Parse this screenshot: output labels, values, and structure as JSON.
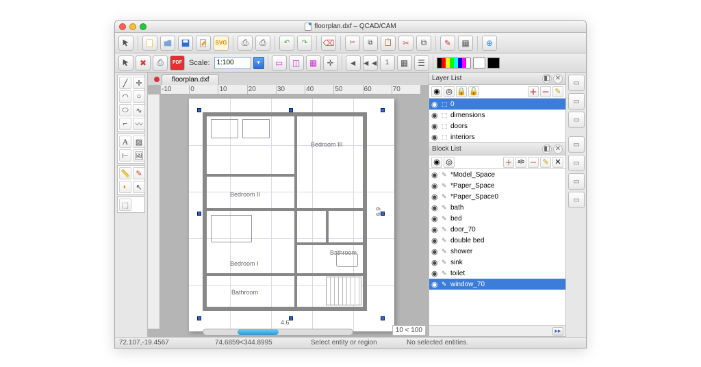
{
  "window": {
    "title": "floorplan.dxf – QCAD/CAM"
  },
  "tab": {
    "label": "floorplan.dxf"
  },
  "toolbar2": {
    "scale_label": "Scale:",
    "scale_value": "1:100",
    "page_num": "1"
  },
  "ruler_h": [
    "-10",
    "0",
    "10",
    "20",
    "30",
    "40",
    "50",
    "60",
    "70"
  ],
  "rooms": {
    "br3": "Bedroom III",
    "br2": "Bedroom II",
    "br1": "Bedroom I",
    "bath1": "Bathroom",
    "bath2": "Bathroom"
  },
  "dims": {
    "width": "4.6",
    "height": "6.9"
  },
  "zoom": "10 < 100",
  "layer_panel": {
    "title": "Layer List",
    "items": [
      {
        "name": "0",
        "selected": true
      },
      {
        "name": "dimensions",
        "selected": false
      },
      {
        "name": "doors",
        "selected": false
      },
      {
        "name": "interiors",
        "selected": false
      }
    ]
  },
  "block_panel": {
    "title": "Block List",
    "items": [
      {
        "name": "*Model_Space",
        "selected": false
      },
      {
        "name": "*Paper_Space",
        "selected": false
      },
      {
        "name": "*Paper_Space0",
        "selected": false
      },
      {
        "name": "bath",
        "selected": false
      },
      {
        "name": "bed",
        "selected": false
      },
      {
        "name": "door_70",
        "selected": false
      },
      {
        "name": "double bed",
        "selected": false
      },
      {
        "name": "shower",
        "selected": false
      },
      {
        "name": "sink",
        "selected": false
      },
      {
        "name": "toilet",
        "selected": false
      },
      {
        "name": "window_70",
        "selected": true
      }
    ]
  },
  "status": {
    "coord1": "72.107,-19.4567",
    "coord2": "74.6859<344.8995",
    "hint": "Select entity or region",
    "sel": "No selected entities."
  },
  "icons": {
    "plus": "+",
    "minus": "−",
    "pencil": "✎",
    "eye": "◉",
    "lock": "🔒",
    "undo": "↶",
    "redo": "↷",
    "cut": "✂",
    "copy": "⧉",
    "paste": "📋",
    "search": "🔍",
    "save": "💾"
  }
}
